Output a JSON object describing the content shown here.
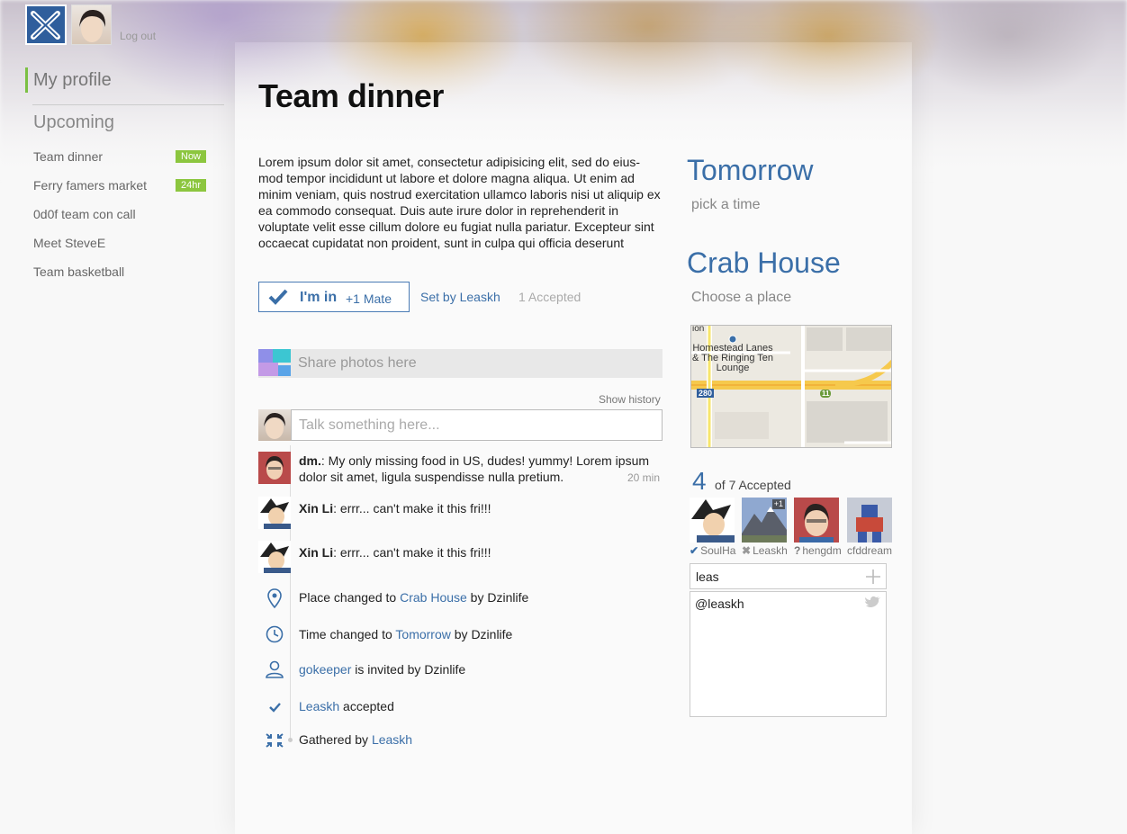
{
  "header": {
    "logout_label": "Log out"
  },
  "sidebar": {
    "profile_label": "My profile",
    "upcoming_title": "Upcoming",
    "events": [
      {
        "name": "Team dinner",
        "badge": "Now"
      },
      {
        "name": "Ferry famers market",
        "badge": "24hr"
      },
      {
        "name": "0d0f team con call",
        "badge": ""
      },
      {
        "name": "Meet SteveE",
        "badge": ""
      },
      {
        "name": "Team basketball",
        "badge": ""
      }
    ]
  },
  "event": {
    "title": "Team dinner",
    "description": "Lorem ipsum dolor sit amet, consectetur adipisicing elit, sed do eius-mod tempor incididunt ut labore et dolore magna aliqua. Ut enim ad minim veniam, quis nostrud exercitation ullamco laboris nisi ut aliquip ex ea commodo consequat. Duis aute irure dolor in reprehenderit in voluptate velit esse cillum dolore eu fugiat nulla pariatur. Excepteur sint occaecat cupidatat non proident, sunt in culpa qui officia deserunt",
    "im_in_label": "I'm in",
    "plus_mate": "+1 Mate",
    "set_by": "Set by Leaskh",
    "accepted": "1 Accepted",
    "share_photos": "Share photos here",
    "show_history": "Show history",
    "comment_placeholder": "Talk something here..."
  },
  "messages": [
    {
      "author": "dm.",
      "text": ": My only missing food in US, dudes! yummy! Lorem ipsum dolor sit amet, ligula suspendisse nulla pretium.",
      "time": "20 min"
    },
    {
      "author": "Xin Li",
      "text": ": errr... can't make it this fri!!!"
    },
    {
      "author": "Xin Li",
      "text": ": errr... can't make it this fri!!!"
    }
  ],
  "activities": {
    "place": {
      "prefix": "Place changed to ",
      "link": "Crab House",
      "suffix": " by Dzinlife"
    },
    "time": {
      "prefix": "Time changed to ",
      "link": "Tomorrow",
      "suffix": " by Dzinlife"
    },
    "invite": {
      "link": "gokeeper",
      "suffix": " is invited by Dzinlife"
    },
    "accepted": {
      "link": "Leaskh",
      "suffix": " accepted"
    },
    "gathered": {
      "prefix": "Gathered by ",
      "link": "Leaskh"
    }
  },
  "details": {
    "when": "Tomorrow",
    "when_sub": "pick a time",
    "where": "Crab House",
    "where_sub": "Choose a place",
    "map": {
      "label_top": "ion",
      "place_label": "Homestead Lanes & The Ringing Ten Lounge",
      "highway": "280",
      "route": "11"
    },
    "accepted_count": "4",
    "accepted_total": "of 7 Accepted",
    "participants": [
      {
        "name": "SoulHa",
        "status": "✔",
        "status_color": "#3b6fa8"
      },
      {
        "name": "Leaskh",
        "status": "✖",
        "status_color": "#999999",
        "badge": "+1"
      },
      {
        "name": "hengdm",
        "status": "?",
        "status_color": "#777777"
      },
      {
        "name": "cfddream",
        "status": "",
        "status_color": "#777777"
      }
    ],
    "invite_value": "leas",
    "suggestion": "@leaskh"
  },
  "colors": {
    "accent": "#3b6fa8",
    "badge_green": "#8cc63f",
    "profile_bar": "#7bc043"
  }
}
